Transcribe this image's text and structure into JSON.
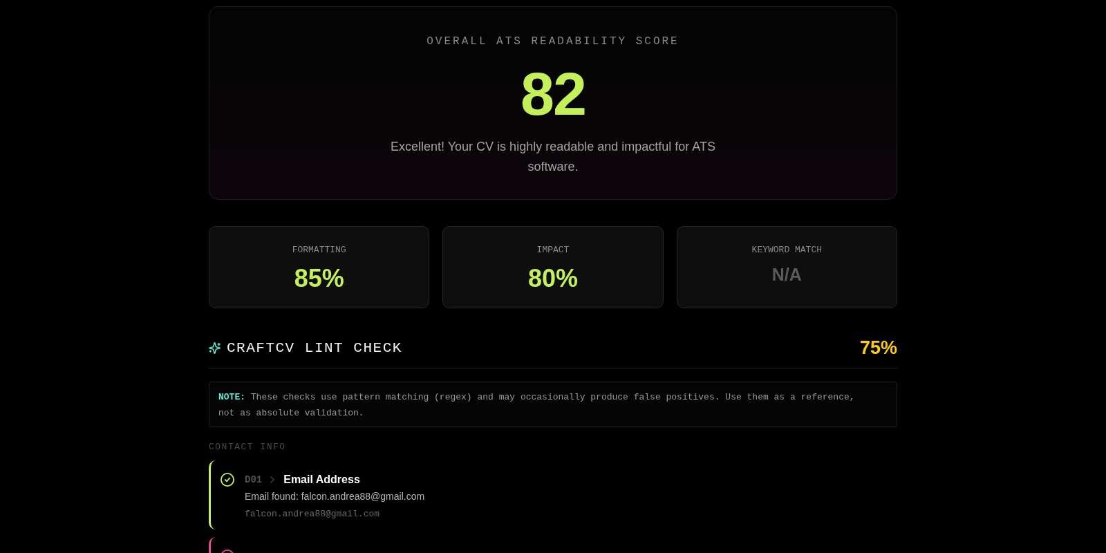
{
  "overall": {
    "label": "OVERALL ATS READABILITY SCORE",
    "score": "82",
    "message": "Excellent! Your CV is highly readable and impactful for ATS software."
  },
  "stats": [
    {
      "label": "FORMATTING",
      "value": "85%",
      "kind": "score"
    },
    {
      "label": "IMPACT",
      "value": "80%",
      "kind": "score"
    },
    {
      "label": "KEYWORD MATCH",
      "value": "N/A",
      "kind": "na"
    }
  ],
  "lint": {
    "title": "CRAFTCV LINT CHECK",
    "score": "75%",
    "note": "**NOTE:** These checks use pattern matching (regex) and may occasionally produce false positives. Use them as a reference, not as absolute validation.",
    "sections": [
      {
        "title": "CONTACT INFO",
        "items": [
          {
            "code": "D01",
            "title": "Email Address",
            "passed": true,
            "message": "Email found: falcon.andrea88@gmail.com",
            "evidence": "falcon.andrea88@gmail.com"
          },
          {
            "passed": false
          }
        ]
      }
    ]
  }
}
